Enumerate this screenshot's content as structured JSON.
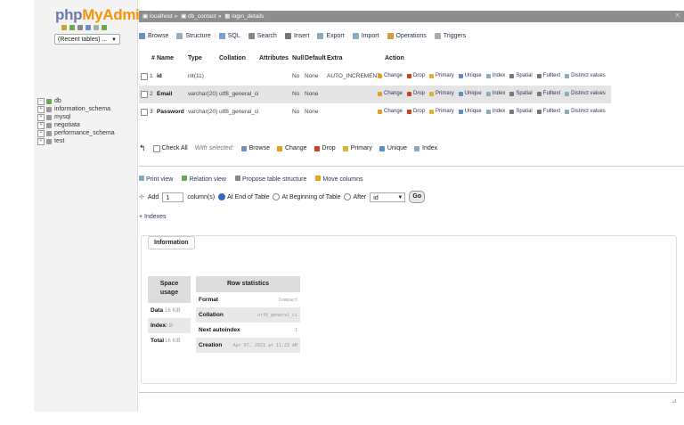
{
  "logo": {
    "php": "php",
    "my": "My",
    "admin": "Admin"
  },
  "recent_tables": {
    "label": "(Recent tables) ..."
  },
  "tree": [
    {
      "label": "db",
      "current": true
    },
    {
      "label": "information_schema",
      "current": false
    },
    {
      "label": "mysql",
      "current": false
    },
    {
      "label": "negotiata",
      "current": false
    },
    {
      "label": "performance_schema",
      "current": false
    },
    {
      "label": "test",
      "current": false
    }
  ],
  "breadcrumb": {
    "server": "localhost",
    "database": "db_contact",
    "table": "login_details"
  },
  "tabs": [
    {
      "label": "Browse",
      "icon": "browse-icon",
      "color": "#6b8fc7"
    },
    {
      "label": "Structure",
      "icon": "structure-icon",
      "color": "#9ab"
    },
    {
      "label": "SQL",
      "icon": "sql-icon",
      "color": "#7aa0d0"
    },
    {
      "label": "Search",
      "icon": "search-icon",
      "color": "#888"
    },
    {
      "label": "Insert",
      "icon": "insert-icon",
      "color": "#777"
    },
    {
      "label": "Export",
      "icon": "export-icon",
      "color": "#8ab"
    },
    {
      "label": "Import",
      "icon": "import-icon",
      "color": "#8ab"
    },
    {
      "label": "Operations",
      "icon": "operations-icon",
      "color": "#c9a13a"
    },
    {
      "label": "Triggers",
      "icon": "triggers-icon",
      "color": "#aaa"
    }
  ],
  "columns": {
    "num": "#",
    "name": "Name",
    "type": "Type",
    "collation": "Collation",
    "attributes": "Attributes",
    "null": "Null",
    "default": "Default",
    "extra": "Extra",
    "action": "Action"
  },
  "rows": [
    {
      "num": "1",
      "name": "id",
      "type": "int(11)",
      "collation": "",
      "attributes": "",
      "null": "No",
      "default": "None",
      "extra": "AUTO_INCREMENT"
    },
    {
      "num": "2",
      "name": "Email",
      "type": "varchar(20)",
      "collation": "utf8_general_ci",
      "attributes": "",
      "null": "No",
      "default": "None",
      "extra": ""
    },
    {
      "num": "3",
      "name": "Password",
      "type": "varchar(20)",
      "collation": "utf8_general_ci",
      "attributes": "",
      "null": "No",
      "default": "None",
      "extra": ""
    }
  ],
  "row_actions": [
    {
      "label": "Change",
      "color": "#e0a020"
    },
    {
      "label": "Drop",
      "color": "#d04020"
    },
    {
      "label": "Primary",
      "color": "#e0b030"
    },
    {
      "label": "Unique",
      "color": "#5a8fc0"
    },
    {
      "label": "Index",
      "color": "#8ab"
    },
    {
      "label": "Spatial",
      "color": "#777"
    },
    {
      "label": "Fulltext",
      "color": "#777"
    },
    {
      "label": "Distinct values",
      "color": "#8ab"
    }
  ],
  "bulk": {
    "check_all": "Check All",
    "with_selected": "With selected:",
    "actions": [
      {
        "label": "Browse",
        "color": "#6b8fc7"
      },
      {
        "label": "Change",
        "color": "#e0a020"
      },
      {
        "label": "Drop",
        "color": "#d04020"
      },
      {
        "label": "Primary",
        "color": "#e0b030"
      },
      {
        "label": "Unique",
        "color": "#5a8fc0"
      },
      {
        "label": "Index",
        "color": "#8ab"
      }
    ]
  },
  "links": {
    "print_view": "Print view",
    "relation_view": "Relation view",
    "propose": "Propose table structure",
    "move_columns": "Move columns"
  },
  "add": {
    "label": "Add",
    "count": "1",
    "columns_label": "column(s)",
    "at_end": "At End of Table",
    "at_beginning": "At Beginning of Table",
    "after": "After",
    "after_field": "id",
    "go": "Go"
  },
  "indexes_label": "+ Indexes",
  "information": {
    "legend": "Information",
    "space_usage": {
      "title_line1": "Space",
      "title_line2": "usage",
      "rows": [
        {
          "key": "Data",
          "value": "16 KiB"
        },
        {
          "key": "Index",
          "value": "0 B"
        },
        {
          "key": "Total",
          "value": "16 KiB"
        }
      ]
    },
    "row_stats": {
      "title": "Row statistics",
      "rows": [
        {
          "key": "Format",
          "value": "Compact"
        },
        {
          "key": "Collation",
          "value": "utf8_general_ci"
        },
        {
          "key": "Next autoindex",
          "value": "1"
        },
        {
          "key": "Creation",
          "value": "Apr 07, 2021 at 11:23 AM"
        }
      ]
    }
  }
}
